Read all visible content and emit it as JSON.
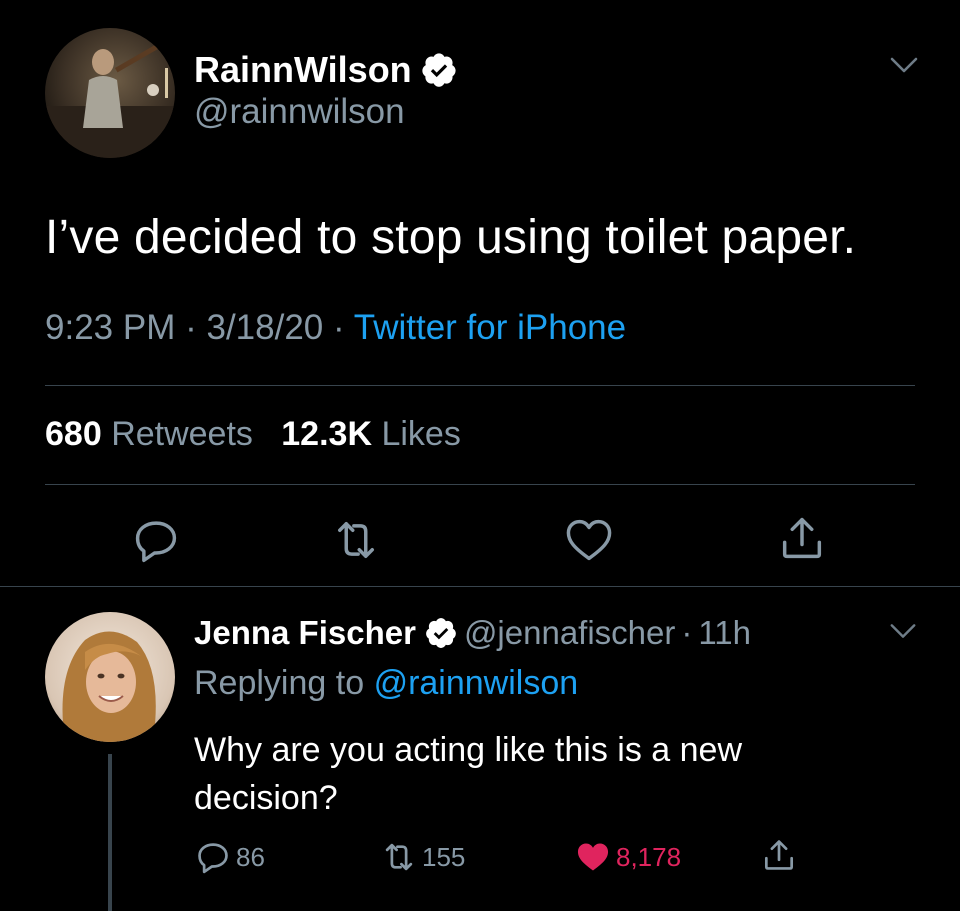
{
  "main_tweet": {
    "author_name": "RainnWilson",
    "author_handle": "@rainnwilson",
    "text": "I’ve decided to stop using toilet paper.",
    "time": "9:23 PM",
    "date": "3/18/20",
    "separator": "·",
    "source": "Twitter for iPhone",
    "retweets_count": "680",
    "retweets_label": "Retweets",
    "likes_count": "12.3K",
    "likes_label": "Likes"
  },
  "reply_tweet": {
    "author_name": "Jenna Fischer",
    "author_handle": "@jennafischer",
    "separator": "·",
    "time": "11h",
    "replying_prefix": "Replying to",
    "replying_mention": "@rainnwilson",
    "text": "Why are you acting like this is a new decision?",
    "reply_count": "86",
    "retweet_count": "155",
    "like_count": "8,178"
  },
  "icons": {
    "verified": "verified-badge-icon",
    "chevron": "chevron-down-icon",
    "reply": "speech-bubble-icon",
    "retweet": "retweet-arrows-icon",
    "like": "heart-icon",
    "share": "share-upload-icon"
  },
  "colors": {
    "background": "#000000",
    "text_primary": "#ffffff",
    "text_secondary": "#8899a6",
    "link": "#1da1f2",
    "like_active": "#e0245e",
    "divider": "#38444d"
  }
}
